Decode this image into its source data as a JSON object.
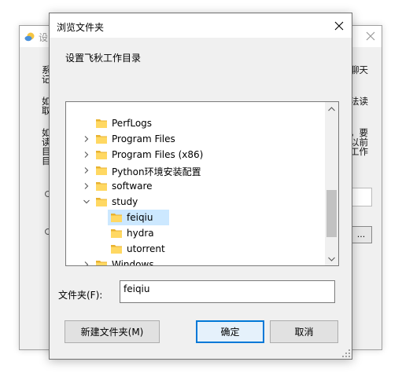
{
  "background_window": {
    "title": "设",
    "left_text": [
      "系",
      "记",
      "如",
      "取",
      "如",
      "读",
      "目",
      "目"
    ],
    "right_text": [
      "聊天",
      "法读",
      "，要",
      "以前",
      "工作"
    ],
    "button_label": "..."
  },
  "dialog": {
    "title": "浏览文件夹",
    "description": "设置飞秋工作目录",
    "tree": {
      "items": [
        {
          "label": "PerfLogs",
          "level": 0,
          "expander": "none"
        },
        {
          "label": "Program Files",
          "level": 0,
          "expander": "collapsed"
        },
        {
          "label": "Program Files (x86)",
          "level": 0,
          "expander": "collapsed"
        },
        {
          "label": "Python环境安装配置",
          "level": 0,
          "expander": "collapsed"
        },
        {
          "label": "software",
          "level": 0,
          "expander": "collapsed"
        },
        {
          "label": "study",
          "level": 0,
          "expander": "expanded"
        },
        {
          "label": "feiqiu",
          "level": 1,
          "expander": "none",
          "selected": true
        },
        {
          "label": "hydra",
          "level": 1,
          "expander": "none"
        },
        {
          "label": "utorrent",
          "level": 1,
          "expander": "none"
        },
        {
          "label": "Windows",
          "level": 0,
          "expander": "collapsed"
        }
      ]
    },
    "folder_label": "文件夹(F):",
    "folder_value": "feiqiu",
    "new_folder_button": "新建文件夹(M)",
    "ok_button": "确定",
    "cancel_button": "取消"
  },
  "colors": {
    "selection": "#cce8ff",
    "default_button_border": "#0078d7",
    "folder": "#ffd862"
  },
  "icons": {
    "close": "close-icon",
    "folder": "folder-icon",
    "expand": "chevron-right-icon",
    "collapse": "chevron-down-icon"
  }
}
